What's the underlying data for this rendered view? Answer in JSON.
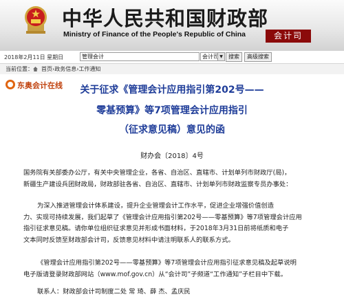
{
  "header": {
    "title_cn": "中华人民共和国财政部",
    "title_en": "Ministry of Finance of the People's Republic of China",
    "department": "会计司"
  },
  "toolbar": {
    "date": "2018年2月11日 星期日",
    "search_value": "管理会计",
    "search_scope": "会计司",
    "search_button": "搜索",
    "advanced_button": "高级搜索"
  },
  "breadcrumb": {
    "prefix": "当前位置：",
    "path": "首页›政务信息›工作通知"
  },
  "source_logo": "东奥会计在线",
  "article": {
    "title_lines": [
      "关于征求《管理会计应用指引第202号——",
      "零基预算》等7项管理会计应用指引",
      "（征求意见稿）意见的函"
    ],
    "doc_number": "财办会〔2018〕4号",
    "paragraphs": [
      [
        "国务院有关部委办公厅，有关中央管理企业，各省、自治区、直辖市、计划单列市财政厅(局)，",
        "新疆生产建设兵团财政局，财政部驻各省、自治区、直辖市、计划单列市财政监察专员办事处："
      ],
      [
        "为深入推进管理会计体系建设，提升企业管理会计工作水平，促进企业增强价值创造",
        "力、实现可持续发展，我们起草了《管理会计应用指引第202号——零基预算》等7项管理会计应用",
        "指引征求意见稿。请你单位组织征求意见并形成书面材料，于2018年3月31日前将纸质和电子",
        "文本同时反馈至财政部会计司，反馈意见材料中请注明联系人的联系方式。"
      ],
      [
        "《管理会计应用指引第202号——零基预算》等7项管理会计应用指引征求意见稿及起草说明",
        "电子版请登录财政部网站（www.mof.gov.cn）从“会计司”子频道“工作通知”子栏目中下载。"
      ],
      [
        "联系人：财政部会计司制度二处 常 琦、薛 杰、孟庆民"
      ]
    ]
  },
  "colors": {
    "title_blue": "#1f3d99",
    "dept_red": "#8b0a0a",
    "logo_orange": "#e06510"
  }
}
